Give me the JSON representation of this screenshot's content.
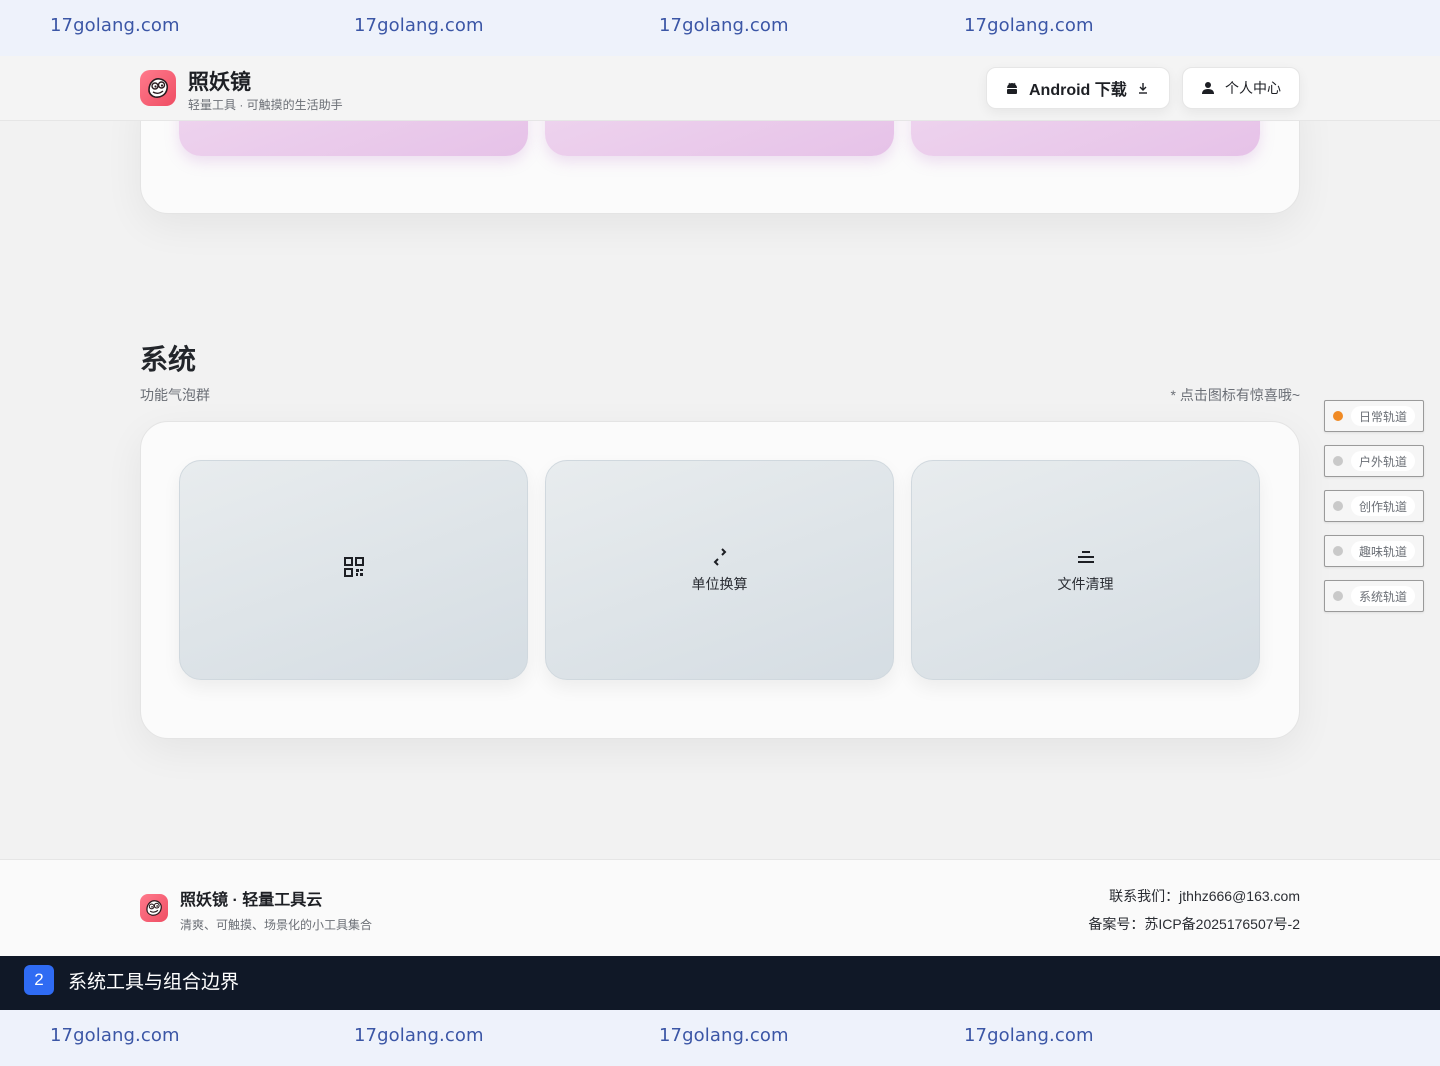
{
  "watermark": {
    "text": "17golang.com"
  },
  "header": {
    "brand_title": "照妖镜",
    "brand_subtitle": "轻量工具 · 可触摸的生活助手",
    "android_button": "Android 下载",
    "user_center_button": "个人中心"
  },
  "section": {
    "title": "系统",
    "subtitle": "功能气泡群",
    "hint": "* 点击图标有惊喜哦~",
    "tools": [
      {
        "icon": "qr-code-icon",
        "label": ""
      },
      {
        "icon": "swap-arrows-icon",
        "label": "单位换算"
      },
      {
        "icon": "clean-lines-icon",
        "label": "文件清理"
      }
    ]
  },
  "side_rail": {
    "active_index": 0,
    "active_color": "#f08a24",
    "items": [
      "日常轨道",
      "户外轨道",
      "创作轨道",
      "趣味轨道",
      "系统轨道"
    ]
  },
  "footer": {
    "title": "照妖镜 · 轻量工具云",
    "subtitle": "清爽、可触摸、场景化的小工具集合",
    "contact": "联系我们：jthhz666@163.com",
    "icp": "备案号：苏ICP备2025176507号-2"
  },
  "caption": {
    "number": "2",
    "text": "系统工具与组合边界"
  }
}
